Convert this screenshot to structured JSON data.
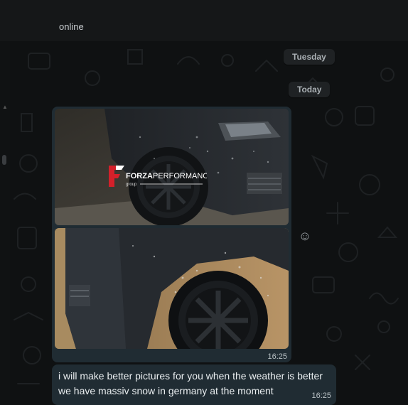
{
  "header": {
    "status": "online"
  },
  "dates": {
    "tuesday": "Tuesday",
    "today": "Today"
  },
  "album": {
    "watermark": {
      "brand": "FORZA PERFORMANCE",
      "sub": "group"
    },
    "time": "16:25",
    "photo_count": 2
  },
  "message": {
    "line1": "i will make better pictures for you when the weather is better",
    "line2": "we have massiv snow in germany at the moment",
    "time": "16:25"
  },
  "icons": {
    "react": "smiley-face-icon"
  },
  "colors": {
    "background": "#0f1112",
    "bubble": "#202c33",
    "chip": "#1f2224",
    "brand_red": "#d3202a"
  }
}
